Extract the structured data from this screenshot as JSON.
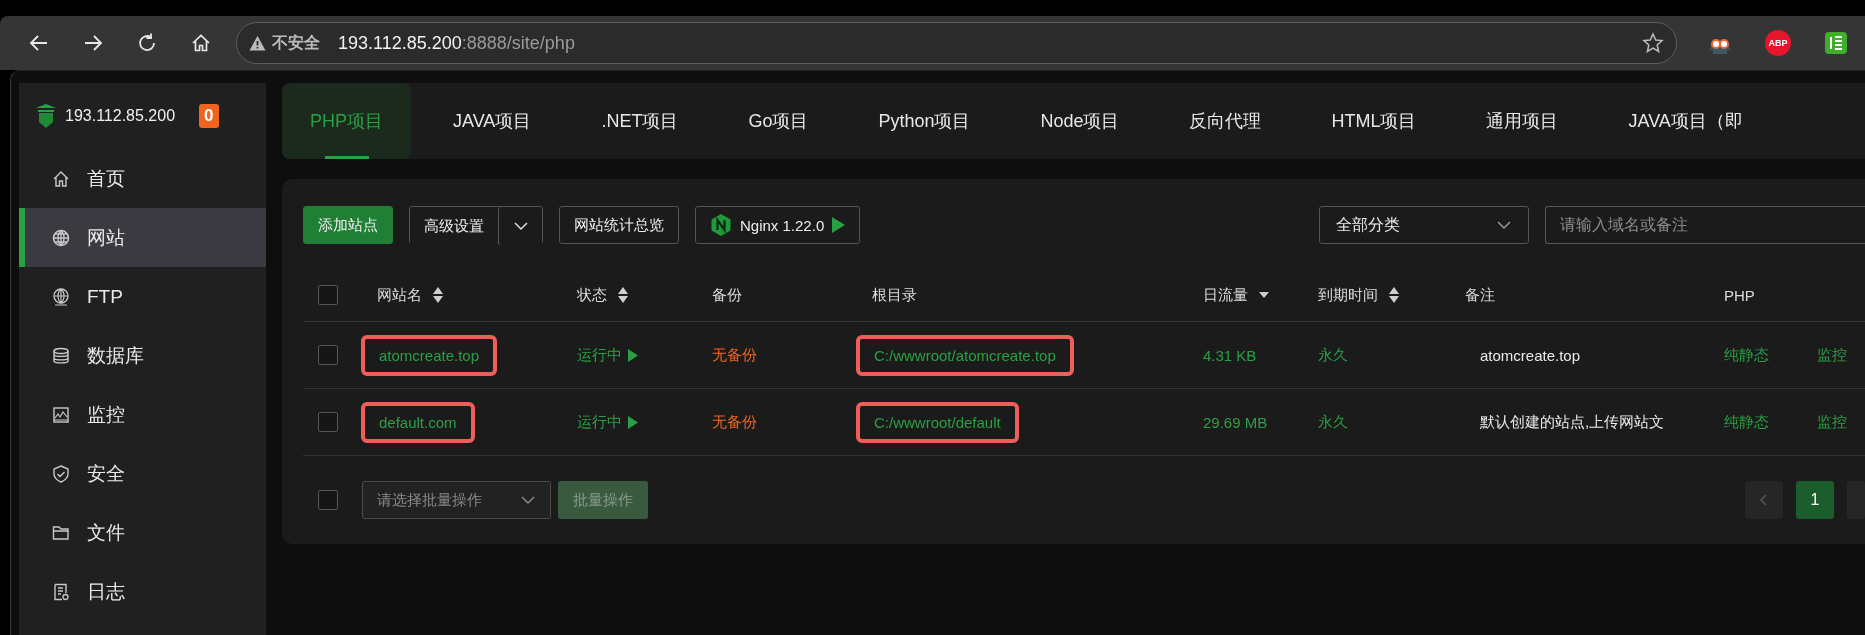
{
  "browser": {
    "security_label": "不安全",
    "url_host": "193.112.85.200",
    "url_rest": ":8888/site/php",
    "extensions": [
      {
        "kind": "goggles"
      },
      {
        "kind": "abp",
        "label": "ABP"
      },
      {
        "kind": "green"
      }
    ]
  },
  "sidebar": {
    "server": "193.112.85.200",
    "badge": "0",
    "items": [
      {
        "label": "首页",
        "kind": "home",
        "selected": false
      },
      {
        "label": "网站",
        "kind": "globe",
        "selected": true
      },
      {
        "label": "FTP",
        "kind": "ftp",
        "selected": false
      },
      {
        "label": "数据库",
        "kind": "database",
        "selected": false
      },
      {
        "label": "监控",
        "kind": "monitor",
        "selected": false
      },
      {
        "label": "安全",
        "kind": "shield",
        "selected": false
      },
      {
        "label": "文件",
        "kind": "folder",
        "selected": false
      },
      {
        "label": "日志",
        "kind": "log",
        "selected": false
      }
    ]
  },
  "tabs": [
    {
      "label": "PHP项目",
      "selected": true
    },
    {
      "label": "JAVA项目",
      "selected": false
    },
    {
      "label": ".NET项目",
      "selected": false
    },
    {
      "label": "Go项目",
      "selected": false
    },
    {
      "label": "Python项目",
      "selected": false
    },
    {
      "label": "Node项目",
      "selected": false
    },
    {
      "label": "反向代理",
      "selected": false
    },
    {
      "label": "HTML项目",
      "selected": false
    },
    {
      "label": "通用项目",
      "selected": false
    },
    {
      "label": "JAVA项目（即",
      "selected": false
    }
  ],
  "toolbar": {
    "add_button": "添加站点",
    "advanced_button": "高级设置",
    "stats_button": "网站统计总览",
    "nginx_button": "Nginx 1.22.0",
    "category_select": "全部分类",
    "search": {
      "placeholder": "请输入域名或备注"
    }
  },
  "table": {
    "header_checked": false,
    "columns": [
      {
        "label": "网站名",
        "kind": "sortable"
      },
      {
        "label": "状态",
        "kind": "sortable"
      },
      {
        "label": "备份",
        "kind": "plain"
      },
      {
        "label": "根目录",
        "kind": "plain"
      },
      {
        "label": "日流量",
        "kind": "sorted"
      },
      {
        "label": "到期时间",
        "kind": "sortable"
      },
      {
        "label": "备注",
        "kind": "plain"
      },
      {
        "label": "PHP",
        "kind": "plain"
      }
    ],
    "rows": [
      {
        "checked": false,
        "name": "atomcreate.top",
        "name_marked": true,
        "status": "运行中",
        "backup": "无备份",
        "root": "C:/wwwroot/atomcreate.top",
        "root_marked": true,
        "traffic": "4.31 KB",
        "expiry": "永久",
        "note": "atomcreate.top",
        "php": "纯静态",
        "action": "监控"
      },
      {
        "checked": false,
        "name": "default.com",
        "name_marked": true,
        "status": "运行中",
        "backup": "无备份",
        "root": "C:/wwwroot/default",
        "root_marked": true,
        "traffic": "29.69 MB",
        "expiry": "永久",
        "note": "默认创建的站点,上传网站文",
        "php": "纯静态",
        "action": "监控"
      }
    ]
  },
  "footer": {
    "checked": false,
    "batch_select": {
      "placeholder": "请选择批量操作"
    },
    "batch_button": {
      "label": "批量操作",
      "disabled": true
    },
    "pages": [
      {
        "label": "1",
        "selected": true
      }
    ]
  }
}
